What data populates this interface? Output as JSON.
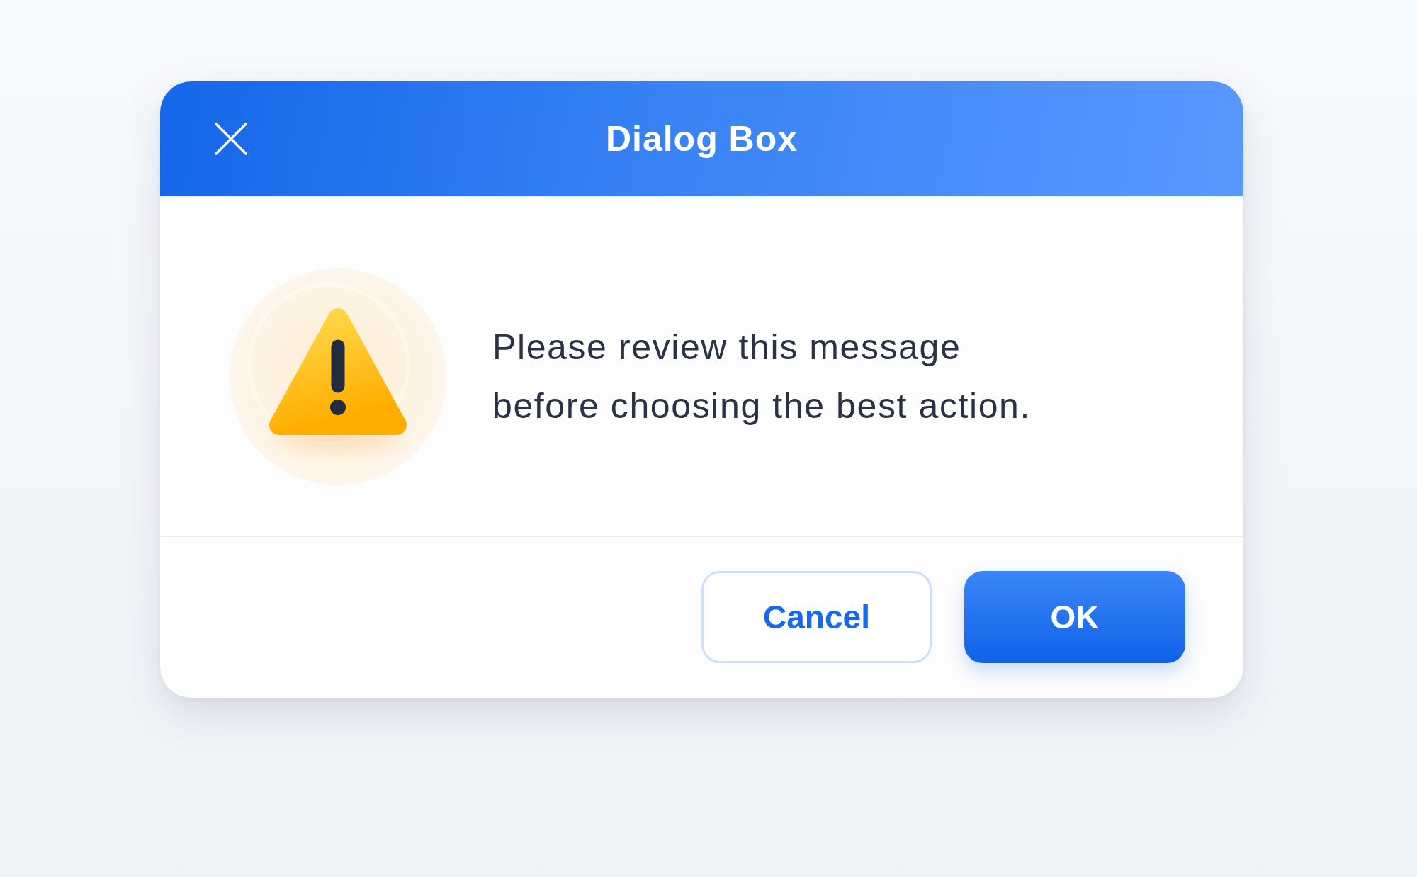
{
  "dialog": {
    "title": "Dialog Box",
    "message_lines": [
      "Please review this message",
      "before choosing the best action."
    ],
    "buttons": [
      {
        "label": "Cancel",
        "kind": "secondary"
      },
      {
        "label": "OK",
        "kind": "primary"
      }
    ]
  }
}
